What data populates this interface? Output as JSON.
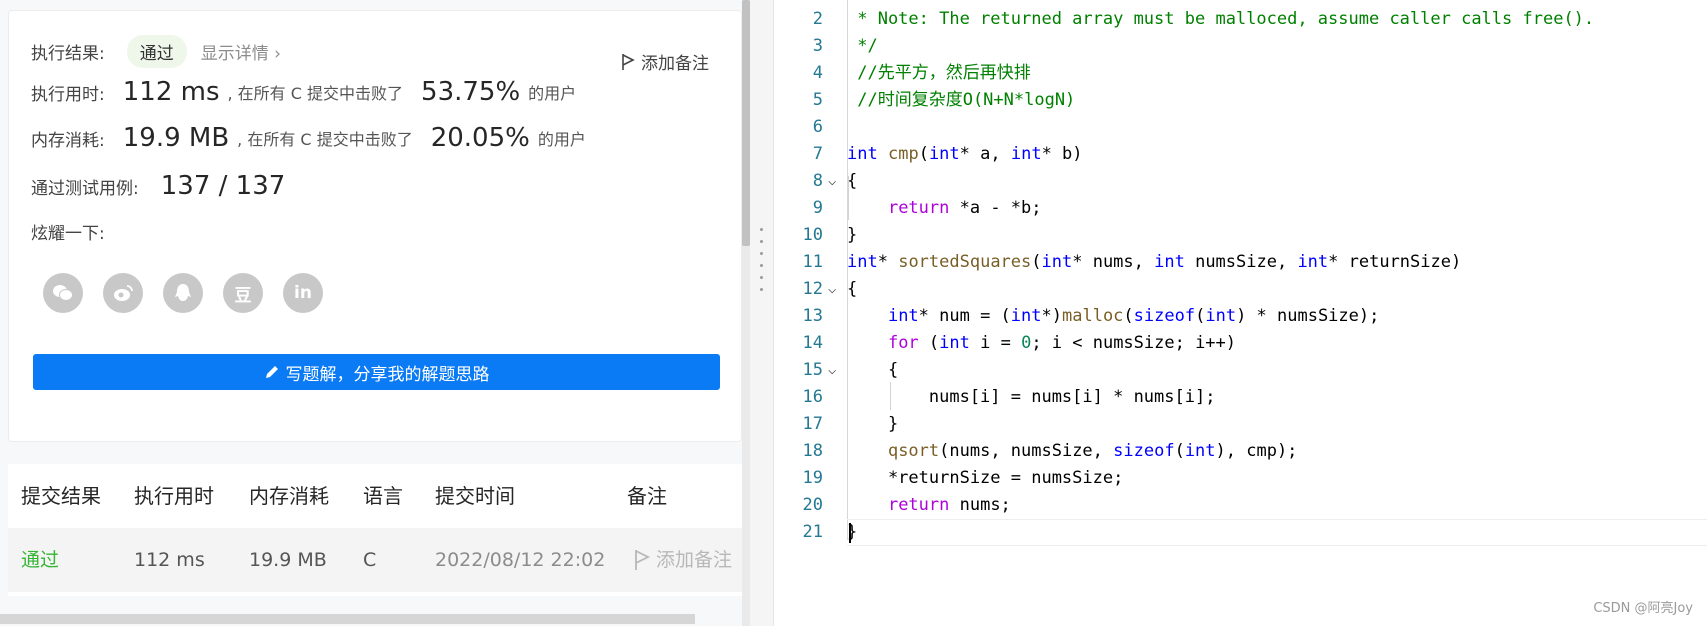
{
  "result": {
    "label": "执行结果:",
    "status": "通过",
    "details_link": "显示详情 ›",
    "add_note": "添加备注",
    "runtime": {
      "label": "执行用时:",
      "value": "112 ms",
      "middle": ", 在所有 C 提交中击败了",
      "percent": "53.75%",
      "suffix": "的用户"
    },
    "memory": {
      "label": "内存消耗:",
      "value": "19.9 MB",
      "middle": ", 在所有 C 提交中击败了",
      "percent": "20.05%",
      "suffix": "的用户"
    },
    "tests": {
      "label": "通过测试用例:",
      "value": "137 / 137"
    },
    "share": {
      "label": "炫耀一下:",
      "icons": [
        "wechat-icon",
        "weibo-icon",
        "qq-icon",
        "douban-icon",
        "linkedin-icon"
      ],
      "douban_glyph": "豆",
      "linkedin_glyph": "in"
    },
    "write_button": "写题解，分享我的解题思路"
  },
  "submissions": {
    "headers": [
      "提交结果",
      "执行用时",
      "内存消耗",
      "语言",
      "提交时间",
      "备注"
    ],
    "rows": [
      {
        "result": "通过",
        "runtime": "112 ms",
        "memory": "19.9 MB",
        "lang": "C",
        "time": "2022/08/12 22:02",
        "note": "添加备注"
      }
    ]
  },
  "editor": {
    "lines": [
      {
        "n": "2",
        "html": "<span class=\"cm\"> * Note: The returned array must be malloced, assume caller calls free().</span>"
      },
      {
        "n": "3",
        "html": "<span class=\"cm\"> */</span>"
      },
      {
        "n": "4",
        "html": "<span class=\"cm\"> //先平方，然后再快排</span>"
      },
      {
        "n": "5",
        "html": "<span class=\"cm\"> //时间复杂度O(N+N*logN)</span>"
      },
      {
        "n": "6",
        "html": ""
      },
      {
        "n": "7",
        "html": "<span class=\"k\">int</span> <span class=\"fn\">cmp</span>(<span class=\"k\">int</span>* a, <span class=\"k\">int</span>* b)"
      },
      {
        "n": "8",
        "html": "{",
        "fold": true
      },
      {
        "n": "9",
        "html": "    <span class=\"kw\">return</span> *a - *b;"
      },
      {
        "n": "10",
        "html": "}"
      },
      {
        "n": "11",
        "html": "<span class=\"k\">int</span>* <span class=\"fn\">sortedSquares</span>(<span class=\"k\">int</span>* nums, <span class=\"k\">int</span> numsSize, <span class=\"k\">int</span>* returnSize)"
      },
      {
        "n": "12",
        "html": "{",
        "fold": true
      },
      {
        "n": "13",
        "html": "    <span class=\"k\">int</span>* num = (<span class=\"k\">int</span>*)<span class=\"fn\">malloc</span>(<span class=\"k\">sizeof</span>(<span class=\"k\">int</span>) * numsSize);"
      },
      {
        "n": "14",
        "html": "    <span class=\"kw\">for</span> (<span class=\"k\">int</span> i = <span class=\"nm\">0</span>; i &lt; numsSize; i++)"
      },
      {
        "n": "15",
        "html": "    {",
        "fold": true
      },
      {
        "n": "16",
        "html": "        nums[i] = nums[i] * nums[i];"
      },
      {
        "n": "17",
        "html": "    }"
      },
      {
        "n": "18",
        "html": "    <span class=\"fn\">qsort</span>(nums, numsSize, <span class=\"k\">sizeof</span>(<span class=\"k\">int</span>), cmp);"
      },
      {
        "n": "19",
        "html": "    *returnSize = numsSize;"
      },
      {
        "n": "20",
        "html": "    <span class=\"kw\">return</span> nums;"
      },
      {
        "n": "21",
        "html": "}"
      }
    ]
  },
  "watermark": "CSDN @阿亮Joy",
  "colors": {
    "accent": "#0a7bf5",
    "success": "#35b534",
    "keyword": "#0000ff",
    "control": "#af00db",
    "comment": "#008000",
    "function": "#795e26"
  }
}
